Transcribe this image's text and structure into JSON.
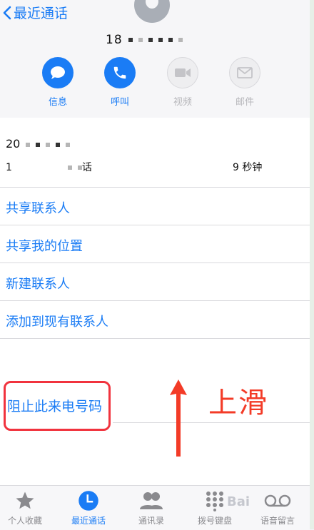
{
  "header": {
    "back_label": "最近通话",
    "number_prefix": "18"
  },
  "actions": [
    {
      "label": "信息",
      "icon": "message-icon",
      "enabled": true
    },
    {
      "label": "呼叫",
      "icon": "phone-icon",
      "enabled": true
    },
    {
      "label": "视频",
      "icon": "video-icon",
      "enabled": false
    },
    {
      "label": "邮件",
      "icon": "mail-icon",
      "enabled": false
    }
  ],
  "call": {
    "date_prefix": "20",
    "type_prefix": "1",
    "type_suffix": "话",
    "duration": "9 秒钟"
  },
  "menu": [
    {
      "label": "共享联系人"
    },
    {
      "label": "共享我的位置"
    },
    {
      "label": "新建联系人"
    },
    {
      "label": "添加到现有联系人"
    }
  ],
  "block": {
    "label": "阻止此来电号码"
  },
  "annotation": {
    "text": "上滑"
  },
  "tabs": [
    {
      "label": "个人收藏",
      "icon": "star-icon",
      "active": false
    },
    {
      "label": "最近通话",
      "icon": "clock-icon",
      "active": true
    },
    {
      "label": "通讯录",
      "icon": "contacts-icon",
      "active": false
    },
    {
      "label": "拨号键盘",
      "icon": "keypad-icon",
      "active": false
    },
    {
      "label": "语音留言",
      "icon": "voicemail-icon",
      "active": false
    }
  ],
  "watermark": {
    "text": "Bai"
  },
  "colors": {
    "accent": "#1a7cf5",
    "annotation_red": "#f33b27",
    "box_red": "#f1333e"
  }
}
